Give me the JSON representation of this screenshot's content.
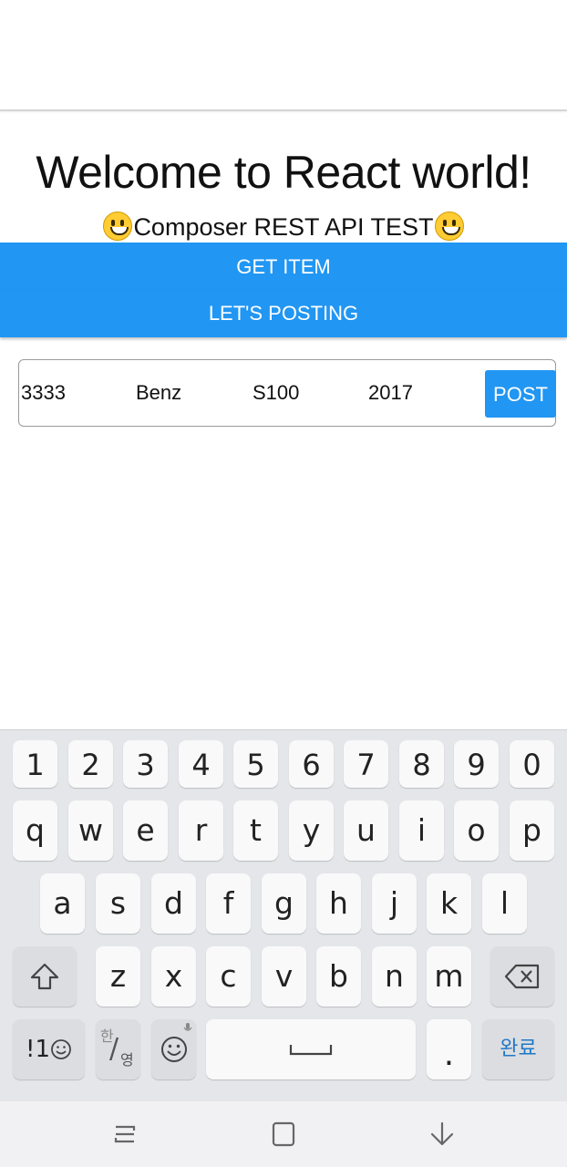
{
  "header": {
    "title": "Welcome to React world!",
    "subtitle": "Composer REST API TEST"
  },
  "buttons": {
    "get_item": "GET ITEM",
    "lets_posting": "LET'S POSTING"
  },
  "form": {
    "fields": [
      "3333",
      "Benz",
      "S100",
      "2017"
    ],
    "post_label": "POST"
  },
  "keyboard": {
    "number_row": [
      "1",
      "2",
      "3",
      "4",
      "5",
      "6",
      "7",
      "8",
      "9",
      "0"
    ],
    "row1": [
      "q",
      "w",
      "e",
      "r",
      "t",
      "y",
      "u",
      "i",
      "o",
      "p"
    ],
    "row2": [
      "a",
      "s",
      "d",
      "f",
      "g",
      "h",
      "j",
      "k",
      "l"
    ],
    "row3": [
      "z",
      "x",
      "c",
      "v",
      "b",
      "n",
      "m"
    ],
    "symbols_label": "!1",
    "lang_top": "한",
    "lang_bottom": "영",
    "period": ".",
    "done_label": "완료"
  },
  "colors": {
    "accent": "#2196f3",
    "keyboard_bg": "#e5e6ea",
    "done_text": "#1e78c8"
  }
}
